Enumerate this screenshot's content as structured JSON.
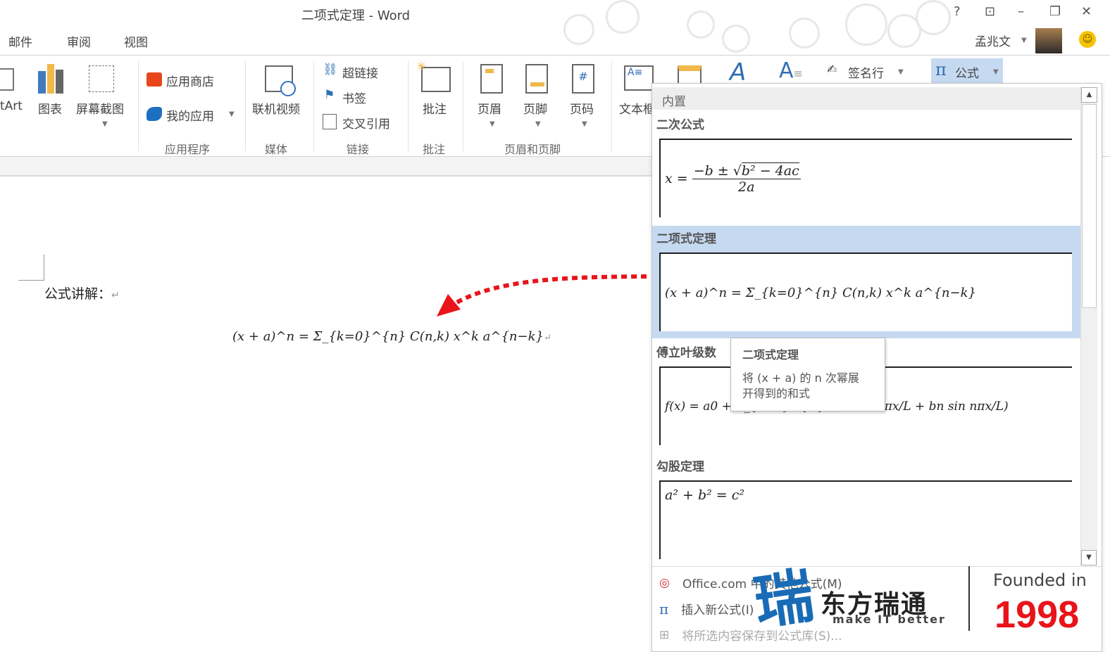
{
  "window": {
    "title": "二项式定理 - Word",
    "help": "?",
    "ribbon_display": "⊡",
    "minimize": "–",
    "restore": "❐",
    "close": "✕",
    "user": "孟兆文",
    "feedback_icon": "smiley-icon"
  },
  "tabs": [
    "邮件",
    "审阅",
    "视图"
  ],
  "ribbon": {
    "smartart": "tArt",
    "chart": "图表",
    "screenshot": "屏幕截图",
    "app_store": "应用商店",
    "my_apps": "我的应用",
    "group_apps": "应用程序",
    "online_video": "联机视频",
    "group_media": "媒体",
    "hyperlink": "超链接",
    "bookmark": "书签",
    "cross_ref": "交叉引用",
    "group_links": "链接",
    "comment": "批注",
    "group_comments": "批注",
    "header": "页眉",
    "footer": "页脚",
    "page_number": "页码",
    "group_header_footer": "页眉和页脚",
    "textbox": "文本框",
    "signature_line": "签名行",
    "equation": "公式"
  },
  "document": {
    "label": "公式讲解：",
    "para_mark": "↵",
    "equation": "(x + a)^n = Σ_{k=0}^{n} C(n,k) x^k a^{n−k}"
  },
  "equation_gallery": {
    "header": "内置",
    "items": [
      {
        "name": "二次公式",
        "formula": "x = (−b ± √(b² − 4ac)) / 2a"
      },
      {
        "name": "二项式定理",
        "formula": "(x + a)^n = Σ_{k=0}^{n} C(n,k) x^k a^{n−k}",
        "selected": true
      },
      {
        "name": "傅立叶级数",
        "formula": "f(x) = a0 + Σ_{n=1}^{∞} (an cos nπx/L + bn sin nπx/L)"
      },
      {
        "name": "勾股定理",
        "formula": "a² + b² = c²"
      }
    ],
    "tooltip": {
      "title": "二项式定理",
      "desc": "将 (x + a) 的 n 次幂展开得到的和式"
    },
    "menu": [
      {
        "label": "Office.com 中的其他公式(M)",
        "icon": "office-icon",
        "enabled": true
      },
      {
        "label": "插入新公式(I)",
        "icon": "pi-icon",
        "enabled": true
      },
      {
        "label": "将所选内容保存到公式库(S)...",
        "icon": "save-equation-icon",
        "enabled": false
      }
    ]
  },
  "watermark": {
    "brand": "东方瑞通",
    "slogan": "make IT better",
    "founded": "Founded in",
    "year": "1998"
  },
  "colors": {
    "accent": "#c5d9f1",
    "arrow": "#e8141a",
    "brand_blue": "#1a6bb5",
    "year_red": "#e8141a"
  }
}
